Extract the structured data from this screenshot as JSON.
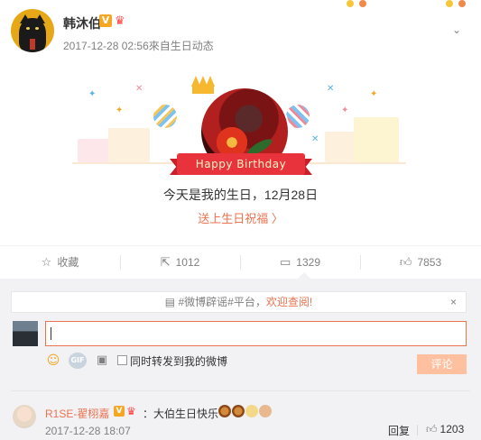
{
  "post": {
    "author": "韩沐伯",
    "verified_badge": "V",
    "crown_badge": "♛",
    "time": "2017-12-28 02:56",
    "source": "來自生日动态",
    "more_icon": "chevron-down-icon"
  },
  "birthday_card": {
    "banner_text": "Happy Birthday",
    "message": "今天是我的生日，12月28日",
    "send_link": "送上生日祝福 〉"
  },
  "actions": {
    "favorite_label": "收藏",
    "repost_count": "1012",
    "comment_count": "1329",
    "like_count": "7853"
  },
  "comment_box": {
    "notice_prefix": "#微博辟谣#平台，",
    "notice_link": "欢迎查阅!",
    "close": "×",
    "input_value": "",
    "sync_label": "同时转发到我的微博",
    "submit_label": "评论"
  },
  "comments": [
    {
      "user": "R1SE-翟栩嘉",
      "verified_badge": "V",
      "crown_badge": "♛",
      "text": "：大伯生日快乐",
      "time": "2017-12-28 18:07",
      "reply_label": "回复",
      "like_count": "1203"
    }
  ],
  "colors": {
    "accent": "#eb7350",
    "badge": "#f5a623",
    "banner": "#e8323c",
    "muted": "#808080"
  }
}
